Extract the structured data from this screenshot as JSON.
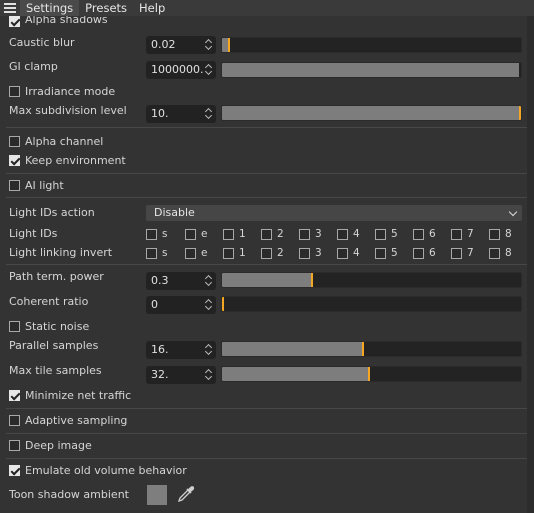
{
  "menu": {
    "settings": "Settings",
    "presets": "Presets",
    "help": "Help"
  },
  "rows": {
    "alpha_shadows": {
      "label": "Alpha shadows",
      "checked": true
    },
    "caustic_blur": {
      "label": "Caustic blur",
      "value": "0.02",
      "slider_level": 0.02
    },
    "gi_clamp": {
      "label": "GI clamp",
      "value": "1000000.",
      "slider_level": 1.0
    },
    "irradiance_mode": {
      "label": "Irradiance mode",
      "checked": false
    },
    "max_subdivision": {
      "label": "Max subdivision level",
      "value": "10.",
      "slider_level": 1.0
    },
    "alpha_channel": {
      "label": "Alpha channel",
      "checked": false
    },
    "keep_environment": {
      "label": "Keep environment",
      "checked": true
    },
    "ai_light": {
      "label": "AI light",
      "checked": false
    },
    "light_ids_action": {
      "label": "Light IDs action",
      "value": "Disable"
    },
    "light_ids": {
      "label": "Light IDs",
      "items": [
        "s",
        "e",
        "1",
        "2",
        "3",
        "4",
        "5",
        "6",
        "7",
        "8"
      ]
    },
    "light_linking_invert": {
      "label": "Light linking invert",
      "items": [
        "s",
        "e",
        "1",
        "2",
        "3",
        "4",
        "5",
        "6",
        "7",
        "8"
      ]
    },
    "path_term_power": {
      "label": "Path term. power",
      "value": "0.3",
      "slider_level": 0.3
    },
    "coherent_ratio": {
      "label": "Coherent ratio",
      "value": "0",
      "slider_level": 0.0
    },
    "static_noise": {
      "label": "Static noise",
      "checked": false
    },
    "parallel_samples": {
      "label": "Parallel samples",
      "value": "16.",
      "slider_level": 0.47
    },
    "max_tile_samples": {
      "label": "Max tile samples",
      "value": "32.",
      "slider_level": 0.49
    },
    "minimize_net_traffic": {
      "label": "Minimize net traffic",
      "checked": true
    },
    "adaptive_sampling": {
      "label": "Adaptive sampling",
      "checked": false
    },
    "deep_image": {
      "label": "Deep image",
      "checked": false
    },
    "emulate_old_volume": {
      "label": "Emulate old volume behavior",
      "checked": true
    },
    "toon_shadow_ambient": {
      "label": "Toon shadow ambient",
      "color": "#7e7e7e"
    }
  },
  "colors": {
    "accent": "#f5a623",
    "panel": "#333333",
    "fill": "#7d7d7d"
  }
}
